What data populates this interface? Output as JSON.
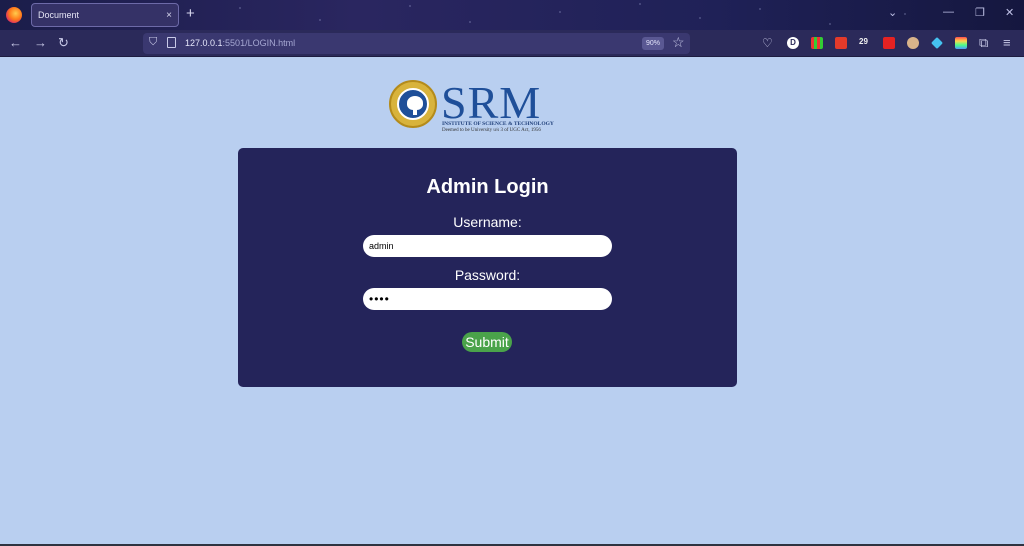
{
  "browser": {
    "tab_title": "Document",
    "tab_close": "×",
    "new_tab": "+",
    "url_host": "127.0.0.1",
    "url_rest": ":5501/LOGIN.html",
    "zoom": "90%",
    "extension_badge": "29"
  },
  "logo": {
    "wordmark": "SRM",
    "line1": "INSTITUTE OF SCIENCE & TECHNOLOGY",
    "line2": "Deemed to be University u/s 3 of UGC Act, 1956"
  },
  "login": {
    "title": "Admin Login",
    "username_label": "Username:",
    "username_value": "admin",
    "password_label": "Password:",
    "password_value": "1234",
    "submit_label": "Submit"
  },
  "colors": {
    "page_background": "#b9cff0",
    "card_background": "#24245a",
    "submit_green": "#4aa34a",
    "srm_blue": "#1f4f99"
  }
}
